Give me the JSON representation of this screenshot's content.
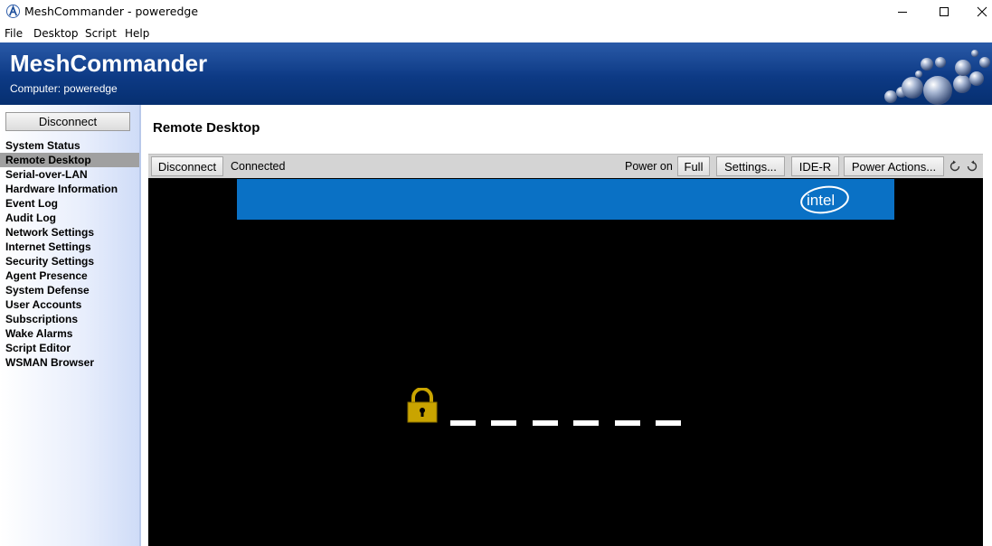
{
  "window": {
    "title": "MeshCommander - poweredge",
    "controls": [
      "minimize-icon",
      "maximize-icon",
      "close-icon"
    ]
  },
  "menu": {
    "items": [
      "File",
      "Desktop",
      "Script",
      "Help"
    ]
  },
  "banner": {
    "title": "MeshCommander",
    "subtitle": "Computer: poweredge"
  },
  "sidebar": {
    "disconnect_label": "Disconnect",
    "items": [
      {
        "label": "System Status",
        "active": false
      },
      {
        "label": "Remote Desktop",
        "active": true
      },
      {
        "label": "Serial-over-LAN",
        "active": false
      },
      {
        "label": "Hardware Information",
        "active": false
      },
      {
        "label": "Event Log",
        "active": false
      },
      {
        "label": "Audit Log",
        "active": false
      },
      {
        "label": "Network Settings",
        "active": false
      },
      {
        "label": "Internet Settings",
        "active": false
      },
      {
        "label": "Security Settings",
        "active": false
      },
      {
        "label": "Agent Presence",
        "active": false
      },
      {
        "label": "System Defense",
        "active": false
      },
      {
        "label": "User Accounts",
        "active": false
      },
      {
        "label": "Subscriptions",
        "active": false
      },
      {
        "label": "Wake Alarms",
        "active": false
      },
      {
        "label": "Script Editor",
        "active": false
      },
      {
        "label": "WSMAN Browser",
        "active": false
      }
    ]
  },
  "main": {
    "page_title": "Remote Desktop",
    "toolbar": {
      "disconnect_label": "Disconnect",
      "status": "Connected",
      "power_state": "Power on",
      "full_label": "Full",
      "settings_label": "Settings...",
      "ider_label": "IDE-R",
      "power_actions_label": "Power Actions...",
      "rotate_icons": [
        "rotate-left-icon",
        "rotate-right-icon"
      ]
    },
    "remote_screen": {
      "brand": "intel",
      "password_mask_count": 6
    }
  },
  "colors": {
    "banner": "#0d3a85",
    "intel_blue": "#0a71c5",
    "lock_gold": "#c9a400",
    "active_item": "#a0a0a0"
  }
}
